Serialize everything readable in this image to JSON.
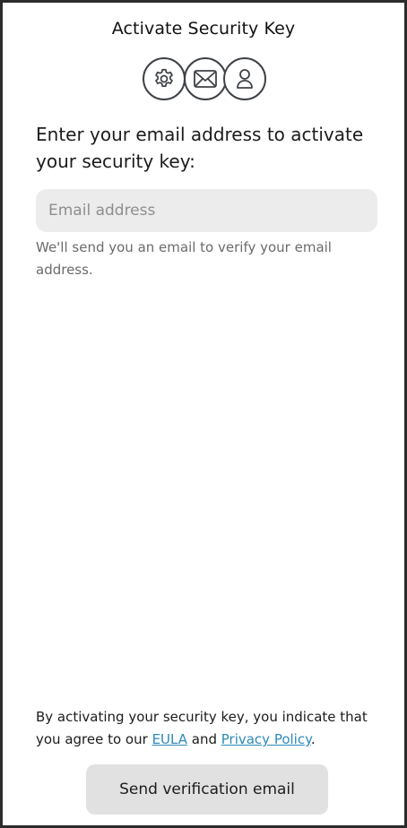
{
  "header": {
    "title": "Activate Security Key"
  },
  "steps": [
    {
      "icon": "gear-icon"
    },
    {
      "icon": "envelope-icon"
    },
    {
      "icon": "person-icon"
    }
  ],
  "main": {
    "prompt": "Enter your email address to activate your security key:",
    "email_placeholder": "Email address",
    "email_value": "",
    "helper_text": "We'll send you an email to verify your email address."
  },
  "footer": {
    "legal_prefix": "By activating your security key, you indicate that you agree to our ",
    "eula_link": "EULA",
    "legal_and": " and ",
    "privacy_link": "Privacy Policy",
    "legal_suffix": ".",
    "send_button_label": "Send verification email"
  },
  "colors": {
    "link": "#2f89b9",
    "button_bg": "#e1e1e2",
    "field_bg": "#ececed",
    "icon_stroke": "#3e4247"
  }
}
